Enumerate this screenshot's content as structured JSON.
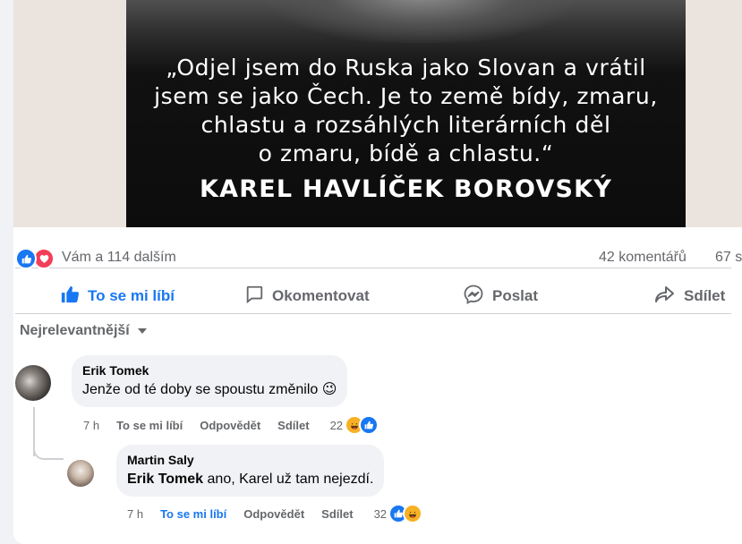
{
  "post": {
    "quote_lines": [
      "„Odjel jsem do Ruska jako Slovan a vrátil",
      "jsem se jako Čech. Je to země bídy, zmaru,",
      "chlastu a rozsáhlých literárních děl",
      "o zmaru, bídě a chlastu.“"
    ],
    "quote_author": "KAREL HAVLÍČEK BOROVSKÝ",
    "reactions_text": "Vám a 114 dalším",
    "comments_count": "42 komentářů",
    "shares_count": "67 s",
    "reaction_icons": [
      "like-icon",
      "love-icon"
    ]
  },
  "actions": {
    "like": "To se mi líbí",
    "comment": "Okomentovat",
    "send": "Poslat",
    "share": "Sdílet"
  },
  "sort": {
    "label": "Nejrelevantnější"
  },
  "comments": [
    {
      "author": "Erik Tomek",
      "text": "Jenže od té doby se spoustu změnilo",
      "emoji": "😉",
      "time": "7 h",
      "like_label": "To se mi líbí",
      "reply_label": "Odpovědět",
      "share_label": "Sdílet",
      "reaction_count": "22",
      "reactions": [
        "haha-icon",
        "like-icon"
      ]
    },
    {
      "author": "Martin Saly",
      "mention": "Erik Tomek",
      "text": " ano, Karel už tam nejezdí.",
      "time": "7 h",
      "like_label": "To se mi líbí",
      "reply_label": "Odpovědět",
      "share_label": "Sdílet",
      "reaction_count": "32",
      "reactions": [
        "like-icon",
        "haha-icon"
      ]
    }
  ],
  "colors": {
    "accent": "#1877f2",
    "love": "#f33e58",
    "haha": "#f7b125",
    "secondary_text": "#65676b",
    "bubble": "#f0f2f5"
  }
}
